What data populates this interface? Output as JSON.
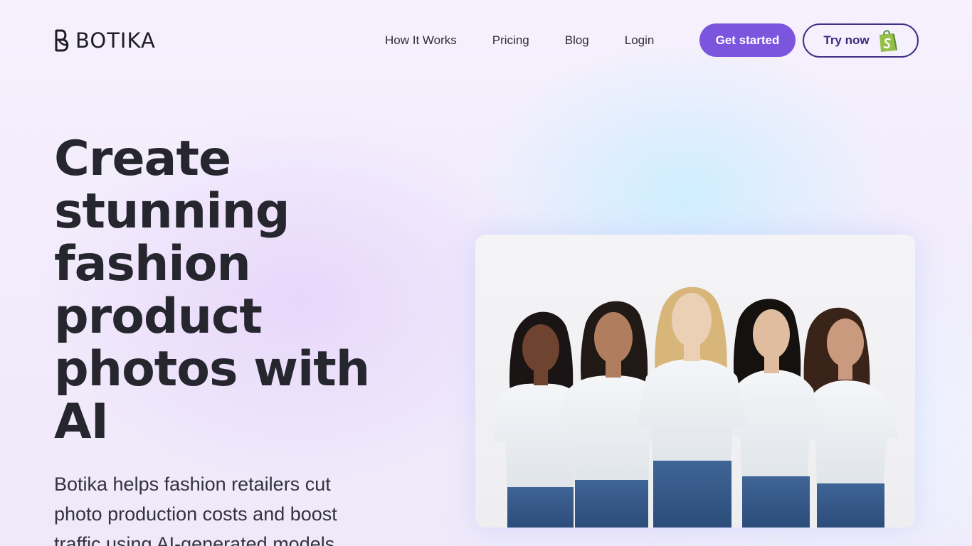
{
  "brand": {
    "name": "BOTIKA"
  },
  "nav": {
    "items": [
      {
        "label": "How It Works"
      },
      {
        "label": "Pricing"
      },
      {
        "label": "Blog"
      },
      {
        "label": "Login"
      }
    ]
  },
  "cta": {
    "get_started": "Get started",
    "try_now": "Try now",
    "try_now_icon": "shopify-bag-icon"
  },
  "hero": {
    "title_lines": [
      "Create",
      "stunning",
      "fashion",
      "product",
      "photos with",
      "AI"
    ],
    "subtitle_lines": [
      "Botika helps fashion retailers cut",
      "photo production costs and boost",
      "traffic using AI-generated models"
    ],
    "image_subject": "five-models-white-tees-jeans"
  },
  "colors": {
    "accent": "#7c55df",
    "outline": "#3f2f86",
    "shopify_green": "#95bf47",
    "text": "#26262e"
  }
}
